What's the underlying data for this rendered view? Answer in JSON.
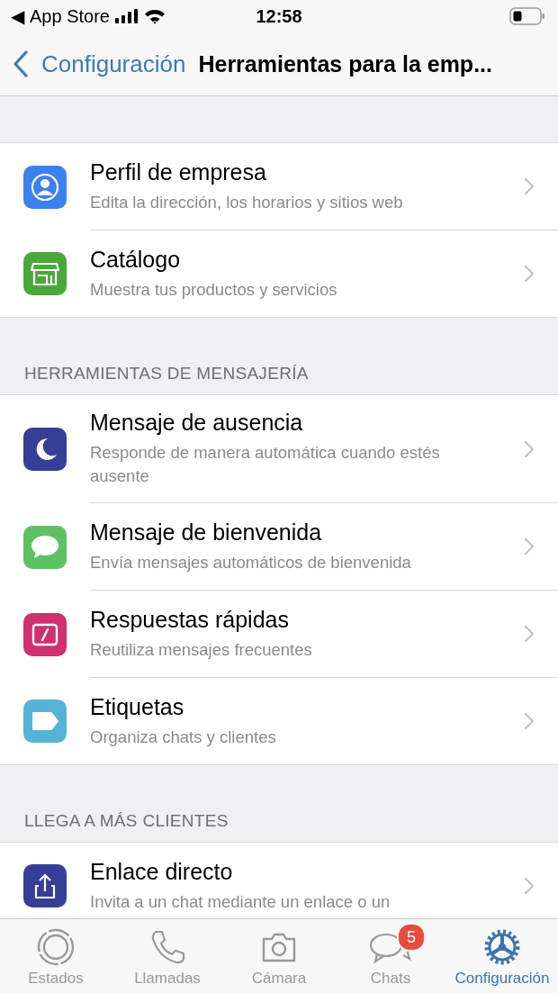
{
  "status_bar": {
    "back_app": "◀",
    "app_name": "App Store",
    "time": "12:58"
  },
  "nav": {
    "back": "Configuración",
    "title": "Herramientas para la emp..."
  },
  "sections": [
    {
      "items": [
        {
          "kind": "profile",
          "color": "#3b82f0",
          "title": "Perfil de empresa",
          "subtitle": "Edita la dirección, los horarios y sitios web"
        },
        {
          "kind": "store",
          "color": "#4aa83a",
          "title": "Catálogo",
          "subtitle": "Muestra tus productos y servicios"
        }
      ]
    },
    {
      "header": "HERRAMIENTAS DE MENSAJERÍA",
      "items": [
        {
          "kind": "moon",
          "color": "#363f97",
          "title": "Mensaje de ausencia",
          "subtitle": "Responde de manera automática cuando estés ausente"
        },
        {
          "kind": "bubble",
          "color": "#5ec264",
          "title": "Mensaje de bienvenida",
          "subtitle": "Envía mensajes automáticos de bienvenida"
        },
        {
          "kind": "reply",
          "color": "#d0306e",
          "title": "Respuestas rápidas",
          "subtitle": "Reutiliza mensajes frecuentes"
        },
        {
          "kind": "label",
          "color": "#55b4d6",
          "title": "Etiquetas",
          "subtitle": "Organiza chats y clientes"
        }
      ]
    },
    {
      "header": "LLEGA A MÁS CLIENTES",
      "items": [
        {
          "kind": "share",
          "color": "#363f97",
          "title": "Enlace directo",
          "subtitle": "Invita a un chat mediante un enlace o un"
        }
      ]
    }
  ],
  "tabs": [
    {
      "kind": "status",
      "label": "Estados",
      "selected": false
    },
    {
      "kind": "calls",
      "label": "Llamadas",
      "selected": false
    },
    {
      "kind": "camera",
      "label": "Cámara",
      "selected": false
    },
    {
      "kind": "chats",
      "label": "Chats",
      "selected": false,
      "badge": "5"
    },
    {
      "kind": "settings",
      "label": "Configuración",
      "selected": true
    }
  ]
}
